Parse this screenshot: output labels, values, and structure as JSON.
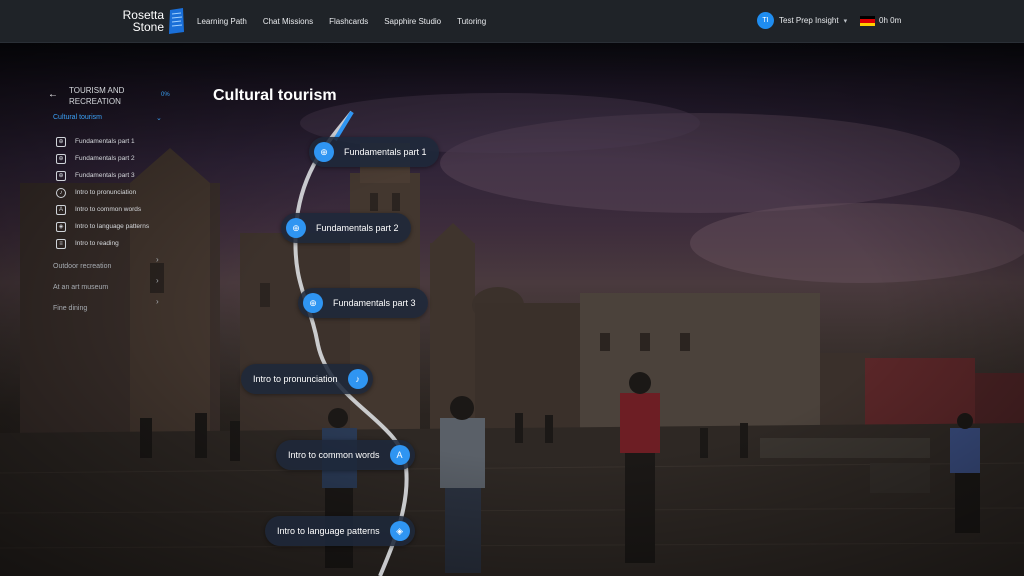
{
  "brand": {
    "line1": "Rosetta",
    "line2": "Stone",
    "logo_icon": "rosetta-stone-logo-icon"
  },
  "nav": {
    "items": [
      {
        "label": "Learning Path"
      },
      {
        "label": "Chat Missions"
      },
      {
        "label": "Flashcards"
      },
      {
        "label": "Sapphire Studio"
      },
      {
        "label": "Tutoring"
      }
    ]
  },
  "user": {
    "initials": "TI",
    "name": "Test Prep Insight",
    "language_flag": "german-flag-icon",
    "time": "0h 0m"
  },
  "sidebar": {
    "back_icon": "arrow-left-icon",
    "unit_title": "TOURISM AND RECREATION",
    "progress": "0%",
    "active_topic": "Cultural tourism",
    "lessons": [
      {
        "label": "Fundamentals part 1",
        "icon": "fundamentals-icon"
      },
      {
        "label": "Fundamentals part 2",
        "icon": "fundamentals-icon"
      },
      {
        "label": "Fundamentals part 3",
        "icon": "fundamentals-icon"
      },
      {
        "label": "Intro to pronunciation",
        "icon": "microphone-icon"
      },
      {
        "label": "Intro to common words",
        "icon": "vocabulary-icon"
      },
      {
        "label": "Intro to language patterns",
        "icon": "patterns-icon"
      },
      {
        "label": "Intro to reading",
        "icon": "reading-icon"
      }
    ],
    "topics": [
      {
        "label": "Outdoor recreation"
      },
      {
        "label": "At an art museum"
      },
      {
        "label": "Fine dining"
      }
    ]
  },
  "main": {
    "title": "Cultural tourism",
    "path_nodes": [
      {
        "label": "Fundamentals part 1",
        "icon": "fundamentals-icon"
      },
      {
        "label": "Fundamentals part 2",
        "icon": "fundamentals-icon"
      },
      {
        "label": "Fundamentals part 3",
        "icon": "fundamentals-icon"
      },
      {
        "label": "Intro to pronunciation",
        "icon": "microphone-icon"
      },
      {
        "label": "Intro to common words",
        "icon": "vocabulary-icon"
      },
      {
        "label": "Intro to language patterns",
        "icon": "patterns-icon"
      }
    ]
  },
  "colors": {
    "accent": "#2f95f2",
    "nav_bg": "#1f2328"
  }
}
